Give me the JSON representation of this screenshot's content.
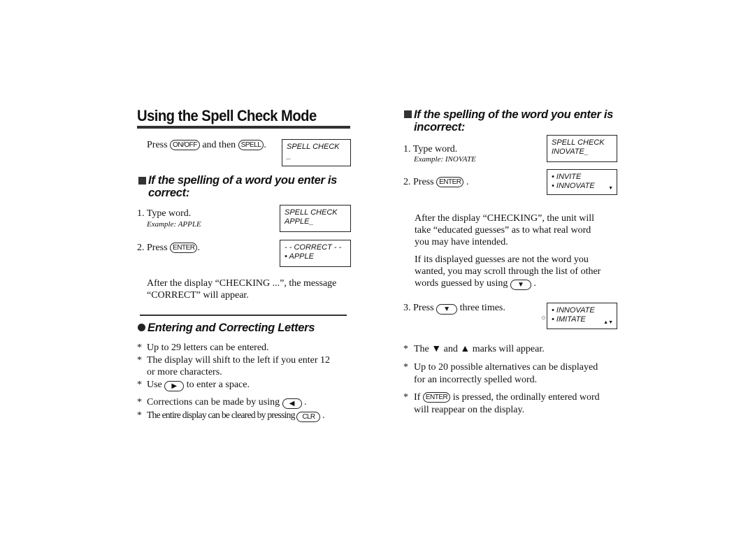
{
  "left": {
    "title": "Using the Spell Check Mode",
    "intro": {
      "press": "Press",
      "key1": "ON/OFF",
      "mid": "and then",
      "key2": "SPELL",
      "end": "."
    },
    "display0": {
      "line1": "SPELL  CHECK",
      "line2": "_"
    },
    "correct_heading_1": "If the spelling of a word you enter is",
    "correct_heading_2": "correct:",
    "step1": "1. Type word.",
    "step1_example": "Example: APPLE",
    "display1": {
      "line1": "SPELL  CHECK",
      "line2": "APPLE_"
    },
    "step2": "2. Press",
    "step2_key": "ENTER",
    "step2_end": ".",
    "display2": {
      "line1": "- - CORRECT - -",
      "line2": "• APPLE"
    },
    "para1": "After the display “CHECKING ...”, the message",
    "para2": "“CORRECT” will appear.",
    "entering_heading": "Entering and Correcting Letters",
    "bullets": [
      {
        "star": "*",
        "text": "Up to 29 letters can be entered."
      },
      {
        "star": "*",
        "text": "The display will shift to the left if you enter 12"
      },
      {
        "star": "",
        "text": "or more characters."
      },
      {
        "star": "*",
        "text": "Use",
        "key": "▶",
        "after": "to enter a space."
      },
      {
        "star": "*",
        "text": "Corrections can be made by using",
        "key": "◀",
        "after": "."
      },
      {
        "star": "*",
        "text": "The entire display can be cleared by pressing",
        "key": "CLR",
        "after": "."
      }
    ]
  },
  "right": {
    "heading_1": "If the spelling of the word you enter is",
    "heading_2": "incorrect:",
    "step1": "1. Type word.",
    "step1_example": "Example: INOVATE",
    "display1": {
      "line1": "SPELL  CHECK",
      "line2": "INOVATE_"
    },
    "step2": "2. Press",
    "step2_key": "ENTER",
    "step2_end": ".",
    "display2": {
      "line1": "• INVITE",
      "line2": "• INNOVATE",
      "indicator": "▼"
    },
    "para1": [
      "After the display “CHECKING”, the unit will",
      "take “educated guesses” as to what real word",
      "you may have intended."
    ],
    "para2": [
      "If its displayed guesses are not the word you",
      "wanted, you may scroll through the list of other",
      "words guessed by using"
    ],
    "para2_key": "▼",
    "para2_end": ".",
    "step3": "3. Press",
    "step3_key": "▼",
    "step3_end": "three times.",
    "display3": {
      "line1": "• INNOVATE",
      "line2": "• IMITATE",
      "indicator": "▲▼"
    },
    "bullets": [
      {
        "star": "*",
        "text": "The ▼ and ▲ marks will appear."
      },
      {
        "star": "*",
        "text": "Up to 20 possible alternatives can be displayed"
      },
      {
        "star": "",
        "text": "for an incorrectly spelled word."
      },
      {
        "star": "*",
        "text": "If",
        "key": "ENTER",
        "after": "is pressed, the ordinally entered word"
      },
      {
        "star": "",
        "text": "will reappear on the display."
      }
    ]
  }
}
